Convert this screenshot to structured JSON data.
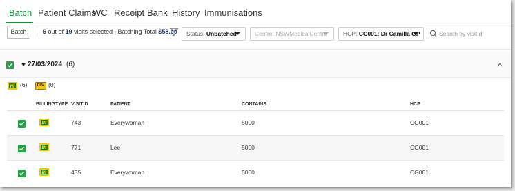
{
  "tabs": [
    {
      "label": "Batch",
      "active": true
    },
    {
      "label": "Patient Claims",
      "active": false
    },
    {
      "label": "WC",
      "active": false
    },
    {
      "label": "Receipt",
      "active": false
    },
    {
      "label": "Bank",
      "active": false
    },
    {
      "label": "History",
      "active": false
    },
    {
      "label": "Immunisations",
      "active": false
    }
  ],
  "toolbar": {
    "batch_button": "Batch",
    "selected": "6",
    "out_of_text": "out of",
    "total_visits": "19",
    "visits_selected_text": "visits selected | Batching Total",
    "batching_total": "$58.00",
    "status_label": "Status:",
    "status_value": "Unbatched",
    "centre_label": "Centre:",
    "centre_value": "NSWMedicalCentre",
    "hcp_label": "HCP:",
    "hcp_value": "CG001: Dr Camilla GP",
    "search_placeholder": "Search by visitId"
  },
  "group": {
    "date": "27/03/2024",
    "count": "(6)",
    "checked": true
  },
  "legend": {
    "medicare_logo": "m",
    "medicare_count": "(6)",
    "dva_logo": "DVA",
    "dva_count": "(0)"
  },
  "table": {
    "columns": [
      "BILLINGTYPE",
      "VISITID",
      "PATIENT",
      "CONTAINS",
      "HCP"
    ],
    "rows": [
      {
        "visitid": "743",
        "patient": "Everywoman",
        "contains": "5000",
        "hcp": "CG001",
        "billing_logo": "m",
        "checked": true
      },
      {
        "visitid": "771",
        "patient": "Lee",
        "contains": "5000",
        "hcp": "CG001",
        "billing_logo": "m",
        "checked": true
      },
      {
        "visitid": "455",
        "patient": "Everywoman",
        "contains": "5000",
        "hcp": "CG001",
        "billing_logo": "m",
        "checked": true
      }
    ]
  },
  "colors": {
    "accent_green": "#1a8f3c",
    "checkbox_green": "#2aa04a",
    "total_blue": "#1f3f7a",
    "medicare_yellow": "#f5c400",
    "medicare_green": "#127a2e"
  },
  "icons": {
    "filter": "filter-icon",
    "search": "search-icon",
    "collapse": "chevron-up-icon",
    "expand": "caret-down-icon",
    "check": "check-icon"
  }
}
